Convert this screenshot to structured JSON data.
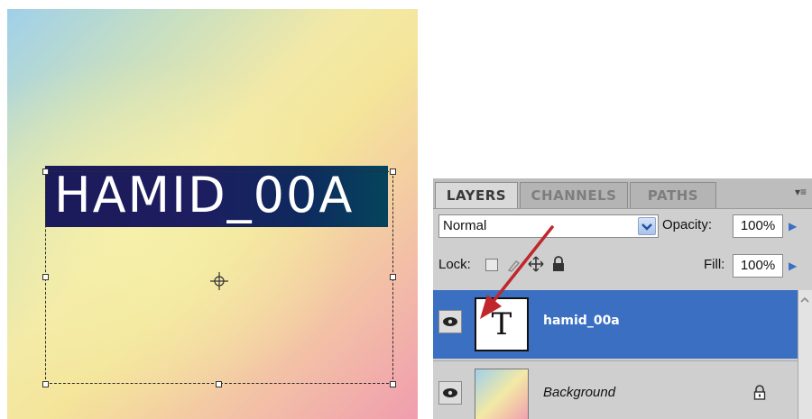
{
  "canvas": {
    "text_layer_text": "HAMID_00A"
  },
  "layers_panel": {
    "tabs": [
      {
        "label": "LAYERS",
        "active": true
      },
      {
        "label": "CHANNELS",
        "active": false
      },
      {
        "label": "PATHS",
        "active": false
      }
    ],
    "panel_menu_icon": "panel-menu-icon",
    "blend_mode": "Normal",
    "opacity_label": "Opacity:",
    "opacity_value": "100%",
    "lock_label": "Lock:",
    "fill_label": "Fill:",
    "fill_value": "100%",
    "layers": [
      {
        "name": "hamid_00a",
        "type": "text",
        "thumb_glyph": "T",
        "selected": true
      },
      {
        "name": "Background",
        "type": "image",
        "locked": true,
        "selected": false
      }
    ]
  },
  "colors": {
    "selection_blue": "#3a6fc2",
    "annotation_arrow": "#c0272d",
    "text_band": "#1d1d60"
  }
}
